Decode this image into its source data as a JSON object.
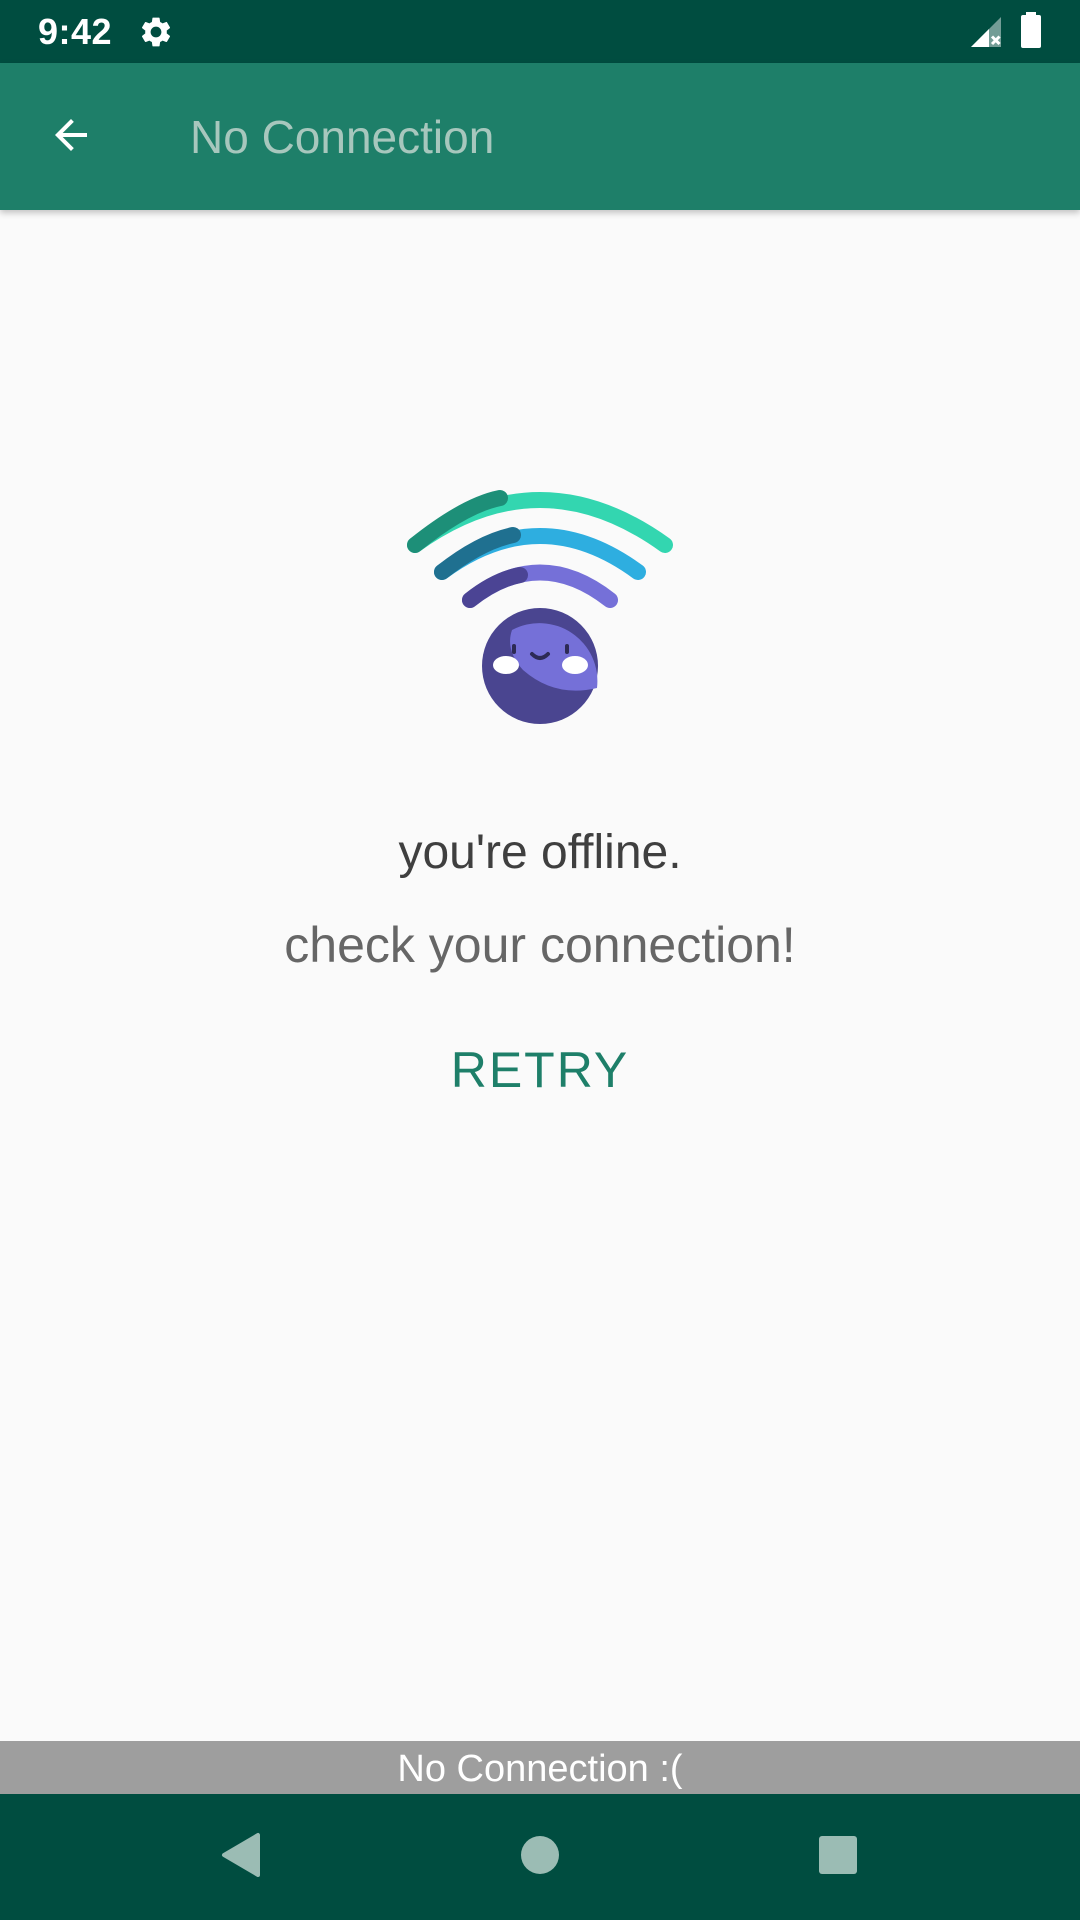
{
  "status_bar": {
    "time": "9:42",
    "icons": [
      "gear-icon",
      "signal-no-data-icon",
      "battery-icon"
    ]
  },
  "app_bar": {
    "title": "No Connection",
    "back_icon": "arrow-back-icon"
  },
  "content": {
    "illustration": "offline-wifi-face-icon",
    "message_primary": "you're offline.",
    "message_secondary": "check your connection!",
    "retry_label": "RETRY"
  },
  "snackbar": {
    "text": "No Connection :("
  },
  "nav_bar": {
    "icons": [
      "nav-back-icon",
      "nav-home-icon",
      "nav-recents-icon"
    ]
  },
  "colors": {
    "status_bar": "#004d40",
    "app_bar": "#1e7f69",
    "accent": "#1e7f69",
    "background": "#fafafa",
    "snackbar": "#9e9e9e"
  }
}
